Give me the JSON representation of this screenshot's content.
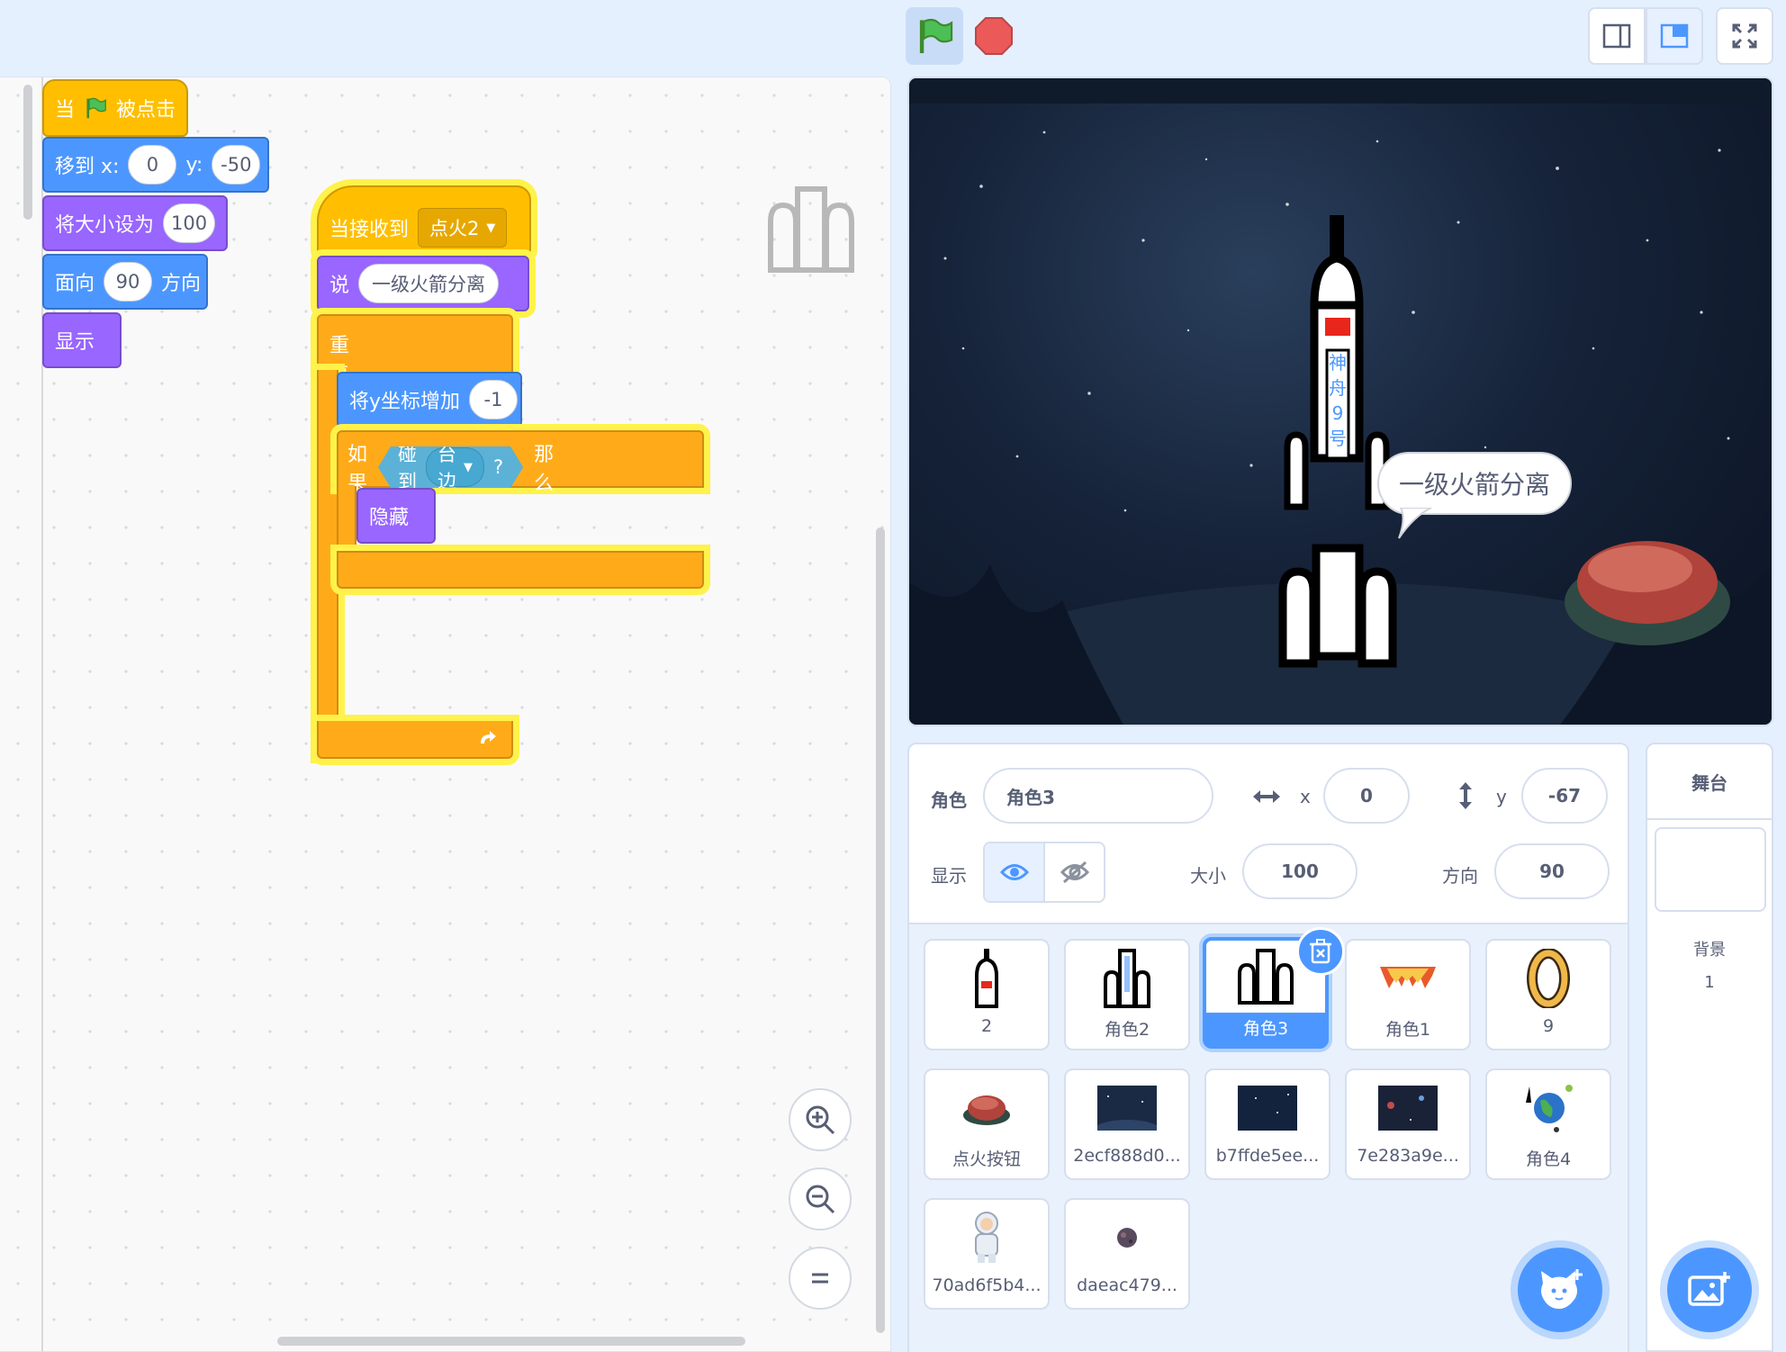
{
  "script1": {
    "hat_prefix": "当",
    "hat_suffix": "被点击",
    "goto_label": "移到 x:",
    "goto_x": "0",
    "goto_y_label": "y:",
    "goto_y": "-50",
    "size_label": "将大小设为",
    "size_value": "100",
    "dir_label": "面向",
    "dir_value": "90",
    "dir_suffix": "方向",
    "show_label": "显示"
  },
  "script2": {
    "hat_label": "当接收到",
    "hat_message": "点火2",
    "say_label": "说",
    "say_text": "一级火箭分离",
    "forever_label": "重复执行",
    "change_y_label": "将y坐标增加",
    "change_y_value": "-1",
    "if_label": "如果",
    "touching_label": "碰到",
    "touching_target": "舞台边缘",
    "question_mark": "?",
    "then_label": "那么",
    "hide_label": "隐藏"
  },
  "stage": {
    "speech": "一级火箭分离",
    "rocket_text": [
      "神",
      "舟",
      "9",
      "号"
    ]
  },
  "sprite_info": {
    "sprite_label": "角色",
    "sprite_name": "角色3",
    "x_label": "x",
    "x_value": "0",
    "y_label": "y",
    "y_value": "-67",
    "show_label": "显示",
    "size_label": "大小",
    "size_value": "100",
    "dir_label": "方向",
    "dir_value": "90"
  },
  "sprites": [
    {
      "name": "2",
      "icon": "rocket-top"
    },
    {
      "name": "角色2",
      "icon": "rocket-body"
    },
    {
      "name": "角色3",
      "icon": "rocket-boosters",
      "selected": true
    },
    {
      "name": "角色1",
      "icon": "flames"
    },
    {
      "name": "9",
      "icon": "digit-zero"
    },
    {
      "name": "点火按钮",
      "icon": "red-button"
    },
    {
      "name": "2ecf888d0...",
      "icon": "space-backdrop"
    },
    {
      "name": "b7ffde5ee...",
      "icon": "space-backdrop"
    },
    {
      "name": "7e283a9e...",
      "icon": "space-backdrop"
    },
    {
      "name": "角色4",
      "icon": "earth-orbit"
    },
    {
      "name": "70ad6f5b4...",
      "icon": "astronaut"
    },
    {
      "name": "daeac479...",
      "icon": "asteroid"
    }
  ],
  "stage_panel": {
    "title": "舞台",
    "backdrop_label": "背景",
    "backdrop_count": "1"
  },
  "colors": {
    "motion": "#4c97ff",
    "looks": "#9966ff",
    "events": "#ffbf00",
    "control": "#ffab19",
    "sensing": "#5cb1d6",
    "selected": "#4c97ff"
  }
}
